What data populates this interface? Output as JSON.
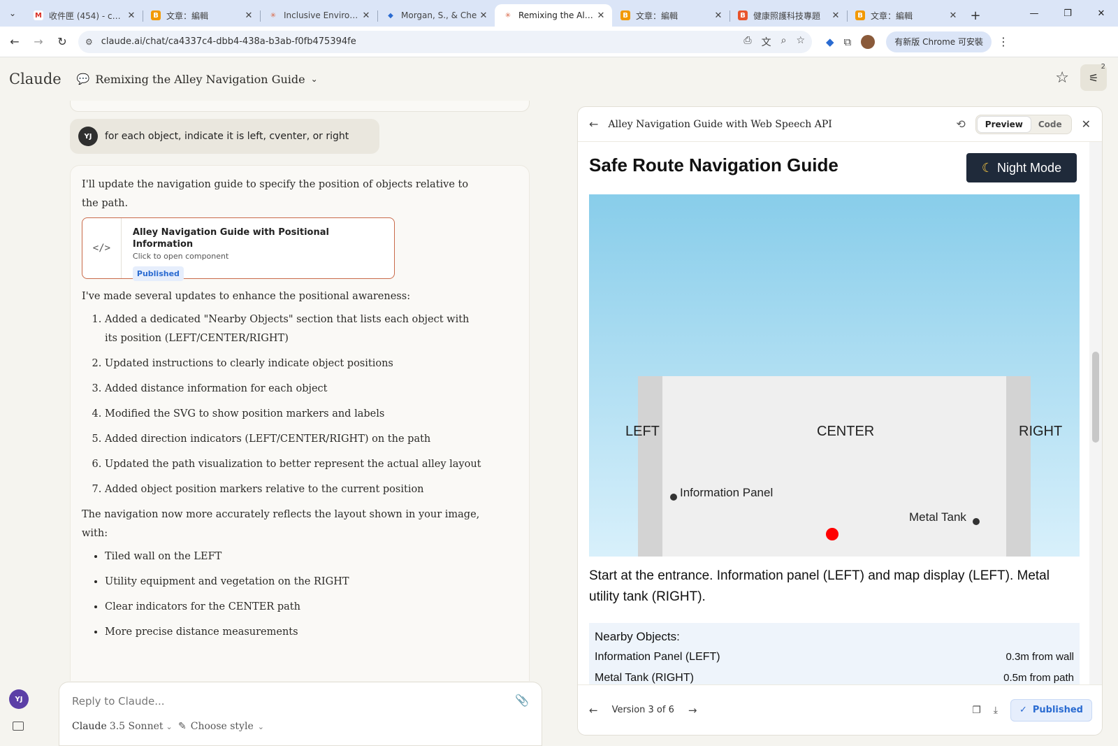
{
  "browser": {
    "tabs": [
      {
        "title": "收件匣 (454) - char",
        "fav_color": "#ffffff",
        "fav_glyph": "M",
        "fav_text": "#d93025"
      },
      {
        "title": "文章：編輯",
        "fav_color": "#f29900",
        "fav_glyph": "B",
        "fav_text": "#ffffff"
      },
      {
        "title": "Inclusive Environm",
        "fav_color": "#dbe5f7",
        "fav_glyph": "✳",
        "fav_text": "#d96a4a"
      },
      {
        "title": "Morgan, S., & Che",
        "fav_color": "#dbe5f7",
        "fav_glyph": "◆",
        "fav_text": "#2a6bd1"
      },
      {
        "title": "Remixing the Alley",
        "fav_color": "#ffffff",
        "fav_glyph": "✳",
        "fav_text": "#d96a4a",
        "active": true
      },
      {
        "title": "文章：編輯",
        "fav_color": "#f29900",
        "fav_glyph": "B",
        "fav_text": "#ffffff"
      },
      {
        "title": "健康照護科技專題",
        "fav_color": "#e8542c",
        "fav_glyph": "B",
        "fav_text": "#ffffff"
      },
      {
        "title": "文章：編輯",
        "fav_color": "#f29900",
        "fav_glyph": "B",
        "fav_text": "#ffffff"
      }
    ],
    "url": "claude.ai/chat/ca4337c4-dbb4-438a-b3ab-f0fb475394fe",
    "update_label": "有新版 Chrome 可安裝"
  },
  "header": {
    "brand": "Claude",
    "chat_title": "Remixing the Alley Navigation Guide",
    "settings_badge": "2"
  },
  "chat": {
    "user_initials": "YJ",
    "user_message": "for each object, indicate it is left, cventer, or right",
    "intro": "I'll update the navigation guide to specify the position of objects relative to the path.",
    "artifact": {
      "title": "Alley Navigation Guide with Positional Information",
      "subtitle": "Click to open component",
      "badge": "Published",
      "icon": "</>"
    },
    "updates_intro": "I've made several updates to enhance the positional awareness:",
    "updates": [
      "Added a dedicated \"Nearby Objects\" section that lists each object with its position (LEFT/CENTER/RIGHT)",
      "Updated instructions to clearly indicate object positions",
      "Added distance information for each object",
      "Modified the SVG to show position markers and labels",
      "Added direction indicators (LEFT/CENTER/RIGHT) on the path",
      "Updated the path visualization to better represent the actual alley layout",
      "Added object position markers relative to the current position"
    ],
    "closing": "The navigation now more accurately reflects the layout shown in your image, with:",
    "bullets": [
      "Tiled wall on the LEFT",
      "Utility equipment and vegetation on the RIGHT",
      "Clear indicators for the CENTER path",
      "More precise distance measurements"
    ]
  },
  "input": {
    "placeholder": "Reply to Claude...",
    "model": "Claude",
    "model_version": "3.5 Sonnet",
    "style": "Choose style"
  },
  "panel": {
    "title": "Alley Navigation Guide with Web Speech API",
    "tabs": [
      "Preview",
      "Code"
    ],
    "active_tab": "Preview",
    "guide_title": "Safe Route Navigation Guide",
    "night_mode": "Night Mode",
    "scene": {
      "labels": {
        "left": "LEFT",
        "center": "CENTER",
        "right": "RIGHT"
      },
      "objects": [
        {
          "name": "Information Panel",
          "side": "left"
        },
        {
          "name": "Metal Tank",
          "side": "right"
        }
      ]
    },
    "instructions": "Start at the entrance. Information panel (LEFT) and map display (LEFT). Metal utility tank (RIGHT).",
    "nearby_title": "Nearby Objects:",
    "nearby": [
      {
        "name": "Information Panel (LEFT)",
        "distance": "0.3m from wall"
      },
      {
        "name": "Metal Tank (RIGHT)",
        "distance": "0.5m from path"
      }
    ],
    "version": "Version 3 of 6",
    "published": "Published"
  }
}
